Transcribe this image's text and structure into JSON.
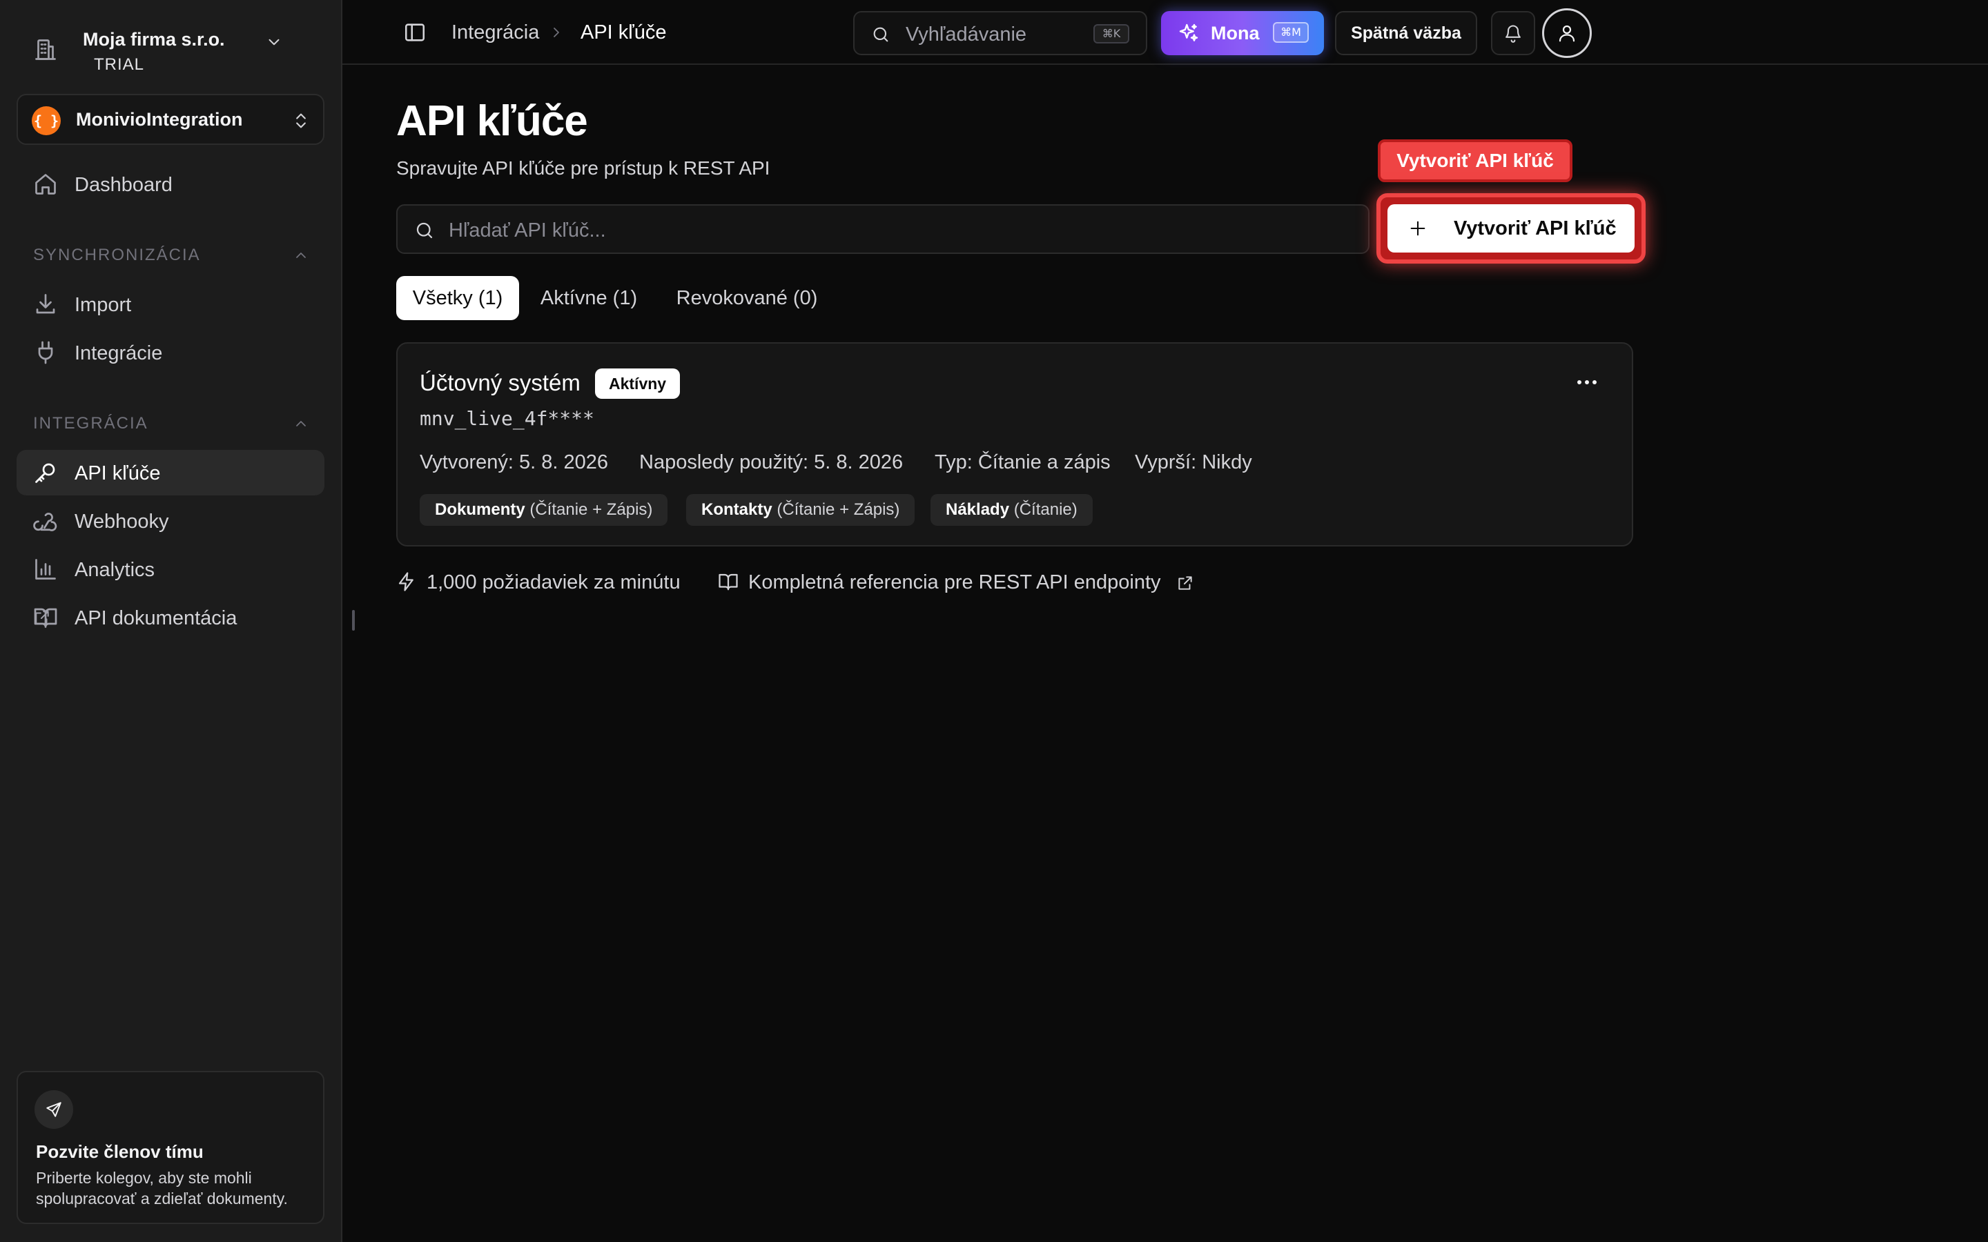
{
  "sidebar": {
    "company": {
      "name": "Moja firma s.r.o.",
      "plan": "TRIAL"
    },
    "organization": {
      "logo_text": "{ }",
      "name": "MonivioIntegration"
    },
    "dashboard": "Dashboard",
    "sections": [
      {
        "title": "SYNCHRONIZÁCIA",
        "items": [
          "Import",
          "Integrácie"
        ]
      },
      {
        "title": "INTEGRÁCIA",
        "items": [
          "API kľúče",
          "Webhooky",
          "Analytics",
          "API dokumentácia"
        ]
      }
    ],
    "active_item": "API kľúče",
    "invite": {
      "title": "Pozvite členov tímu",
      "description": "Priberte kolegov, aby ste mohli spolupracovať a zdieľať dokumenty."
    }
  },
  "topbar": {
    "breadcrumb": [
      "Integrácia",
      "API kľúče"
    ],
    "search": {
      "placeholder": "Vyhľadávanie",
      "shortcut": "⌘K"
    },
    "assistant": {
      "label": "Mona",
      "shortcut": "⌘M"
    },
    "feedback": "Spätná väzba"
  },
  "main": {
    "title": "API kľúče",
    "subtitle": "Spravujte API kľúče pre prístup k REST API",
    "search_placeholder": "Hľadať API kľúč...",
    "create_tooltip": "Vytvoriť API kľúč",
    "create_button": "Vytvoriť API kľúč",
    "tabs": [
      "Všetky (1)",
      "Aktívne (1)",
      "Revokované (0)"
    ],
    "active_tab": "Všetky (1)",
    "keys": [
      {
        "name": "Účtovný systém",
        "status": "Aktívny",
        "key": "mnv_live_4f****",
        "meta": [
          "Vytvorený: 5. 8. 2026",
          "Naposledy použitý: 5. 8. 2026",
          "Typ: Čítanie a zápis",
          "Vyprší: Nikdy"
        ],
        "scopes": [
          {
            "name": "Dokumenty",
            "access": "(Čítanie + Zápis)"
          },
          {
            "name": "Kontakty",
            "access": "(Čítanie + Zápis)"
          },
          {
            "name": "Náklady",
            "access": "(Čítanie)"
          }
        ]
      }
    ],
    "footer": {
      "rate_limit": "1,000 požiadaviek za minútu",
      "docs_link": "Kompletná referencia pre REST API endpointy"
    }
  },
  "colors": {
    "background": "#0b0b0b",
    "sidebar": "#1c1c1c",
    "highlight": "#ef4444",
    "assistant_gradient": [
      "#7c3aed",
      "#3b82f6"
    ],
    "logo": "#f97316"
  }
}
